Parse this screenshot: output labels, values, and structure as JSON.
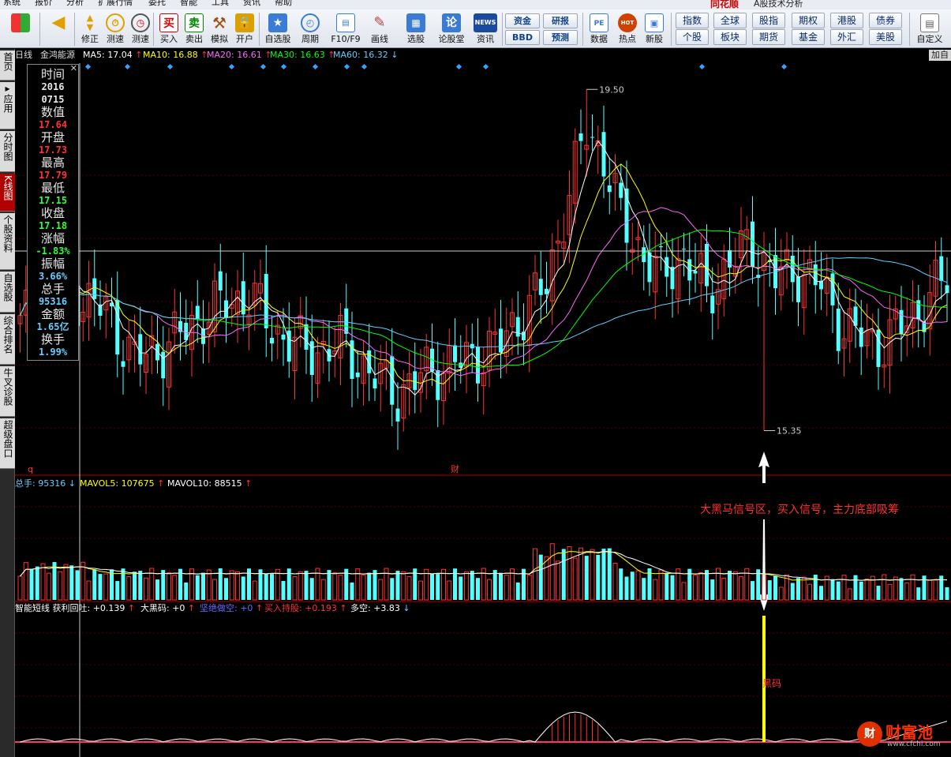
{
  "menu": [
    "系统",
    "报价",
    "分析",
    "扩展行情",
    "委托",
    "智能",
    "工具",
    "资讯",
    "帮助"
  ],
  "brand": "同花顺",
  "app_title": "A股技术分析",
  "toolbar": {
    "buttons": [
      {
        "label": "",
        "icon": "windows-icon"
      },
      {
        "label": "",
        "icon": "back-arrow-icon"
      },
      {
        "label": "修正",
        "icon": "up-down-arrows-icon"
      },
      {
        "label": "测速",
        "icon": "stopwatch-icon"
      },
      {
        "label": "买入",
        "icon": "buy-icon",
        "glyph": "买"
      },
      {
        "label": "卖出",
        "icon": "sell-icon",
        "glyph": "卖"
      },
      {
        "label": "模拟",
        "icon": "hammer-icon"
      },
      {
        "label": "开户",
        "icon": "lock-icon"
      },
      {
        "label": "自选股",
        "icon": "star-icon"
      },
      {
        "label": "周期",
        "icon": "clock-icon"
      },
      {
        "label": "F10/F9",
        "icon": "f10-icon"
      },
      {
        "label": "画线",
        "icon": "pencil-icon"
      },
      {
        "label": "选股",
        "icon": "screen-icon"
      },
      {
        "label": "论股堂",
        "icon": "forum-icon",
        "glyph": "论"
      },
      {
        "label": "资讯",
        "icon": "news-icon",
        "glyph": "NEWS"
      },
      {
        "label": "数据",
        "icon": "pe-icon",
        "glyph": "PE"
      },
      {
        "label": "热点",
        "icon": "hot-icon",
        "glyph": "HOT"
      },
      {
        "label": "新股",
        "icon": "ipo-icon"
      },
      {
        "label": "自定义",
        "icon": "custom-icon"
      }
    ],
    "small_left": [
      "资金",
      "BBD",
      "研报",
      "预测"
    ],
    "small_right": [
      "指数",
      "个股",
      "全球",
      "板块",
      "股指",
      "期货",
      "期权",
      "基金",
      "港股",
      "外汇",
      "债券",
      "美股"
    ]
  },
  "left_tabs": [
    "首页",
    "应用",
    "分时图",
    "K线图",
    "个股资料",
    "自选股",
    "综合排名",
    "牛叉诊股",
    "超级盘口"
  ],
  "info_bar": {
    "period": "日线",
    "stock_name": "金鸿能源",
    "ma": [
      {
        "label": "MA5: 17.04",
        "arrow": "↑",
        "color": "#ffffff"
      },
      {
        "label": "MA10: 16.88",
        "arrow": "↑",
        "color": "#ffff00"
      },
      {
        "label": "MA20: 16.61",
        "arrow": "↑",
        "color": "#ff66ff"
      },
      {
        "label": "MA30: 16.63",
        "arrow": "↑",
        "color": "#00ff00"
      },
      {
        "label": "MA60: 16.32",
        "arrow": "↓",
        "color": "#66ccff"
      }
    ],
    "right_button": "加自"
  },
  "data_window": [
    {
      "label": "时间",
      "value": "2016",
      "value2": "0715",
      "color": "#e8e8e8"
    },
    {
      "label": "数值",
      "value": "17.64",
      "color": "#ff3333"
    },
    {
      "label": "开盘",
      "value": "17.73",
      "color": "#ff3333"
    },
    {
      "label": "最高",
      "value": "17.79",
      "color": "#ff3333"
    },
    {
      "label": "最低",
      "value": "17.15",
      "color": "#33ff33"
    },
    {
      "label": "收盘",
      "value": "17.18",
      "color": "#33ff33"
    },
    {
      "label": "涨幅",
      "value": "-1.83%",
      "color": "#33ff33"
    },
    {
      "label": "振幅",
      "value": "3.66%",
      "color": "#66ccff"
    },
    {
      "label": "总手",
      "value": "95316",
      "color": "#66ccff"
    },
    {
      "label": "金额",
      "value": "1.65亿",
      "color": "#66ccff"
    },
    {
      "label": "换手",
      "value": "1.99%",
      "color": "#66ccff"
    }
  ],
  "price_chart": {
    "high_label": "19.50",
    "low_label": "15.35",
    "marker_cai": "财",
    "marker_q": "q"
  },
  "volume_panel": {
    "items": [
      {
        "label": "总手: 95316",
        "arrow": "↓",
        "color": "#66ccff"
      },
      {
        "label": "MAVOL5: 107675",
        "arrow": "↑",
        "color": "#ffff00"
      },
      {
        "label": "MAVOL10: 88515",
        "arrow": "↑",
        "color": "#ffffff"
      }
    ],
    "annotation": "大黑马信号区，买入信号，主力底部吸筹"
  },
  "indicator_panel": {
    "items": [
      {
        "label": "智能短线 获利回吐: +0.139",
        "arrow": "↑",
        "color": "#ffffff"
      },
      {
        "label": "大黑码: +0",
        "arrow": "↑",
        "color": "#ffffff"
      },
      {
        "label": "坚绝做空: +0",
        "arrow": "↑",
        "color": "#6666ff"
      },
      {
        "label": "买入持股: +0.193",
        "arrow": "↑",
        "color": "#ff3333"
      },
      {
        "label": "多空: +3.83",
        "arrow": "↓",
        "color": "#ffffff"
      }
    ],
    "signal_label": "黑码"
  },
  "watermark": {
    "text": "财富池",
    "url": "www.cfchi.com"
  },
  "colors": {
    "up": "#ff3333",
    "down": "#54ffff",
    "background": "#000000"
  }
}
